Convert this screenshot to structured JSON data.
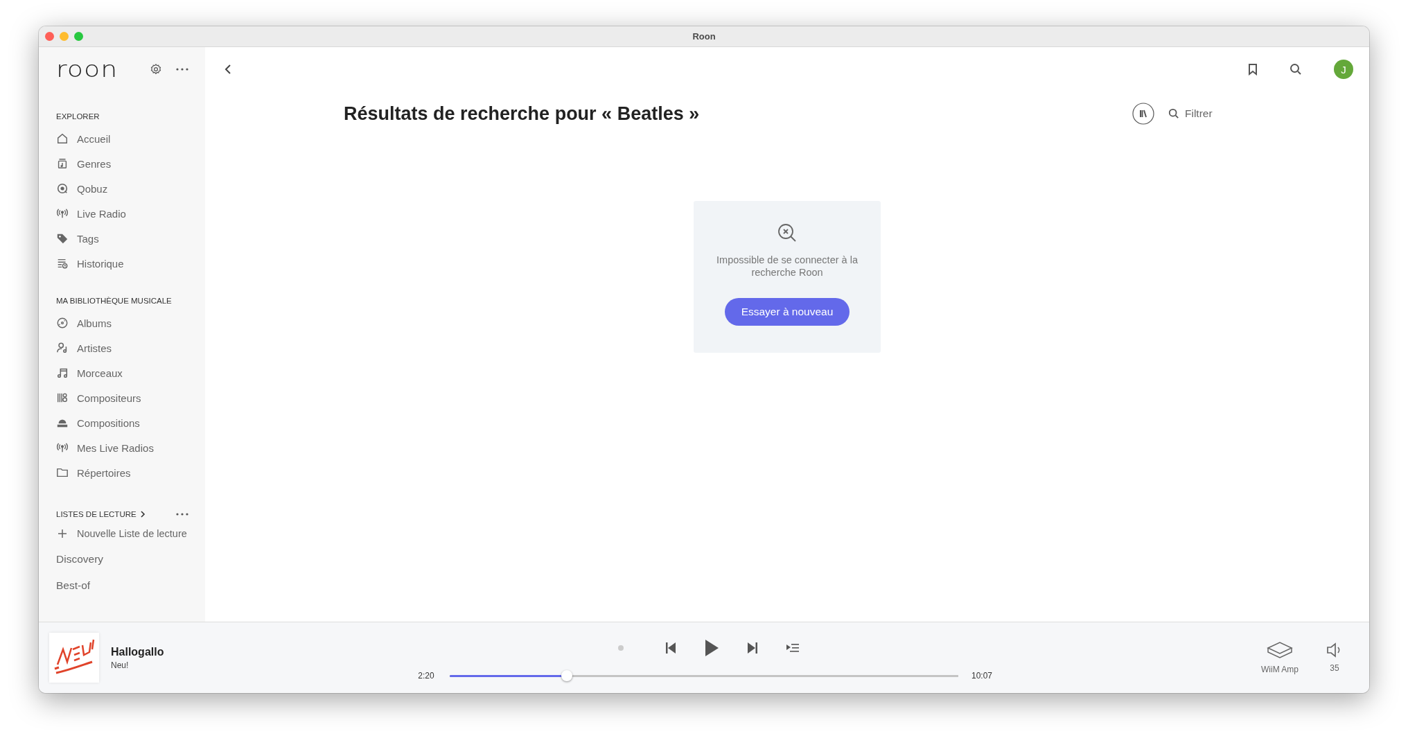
{
  "window": {
    "title": "Roon"
  },
  "sidebar": {
    "logo": "roon",
    "sections": [
      {
        "heading": "EXPLORER",
        "items": [
          {
            "label": "Accueil",
            "kind": "home"
          },
          {
            "label": "Genres",
            "kind": "genres"
          },
          {
            "label": "Qobuz",
            "kind": "qobuz"
          },
          {
            "label": "Live Radio",
            "kind": "radio"
          },
          {
            "label": "Tags",
            "kind": "tag"
          },
          {
            "label": "Historique",
            "kind": "history"
          }
        ]
      },
      {
        "heading": "MA BIBLIOTHÈQUE MUSICALE",
        "items": [
          {
            "label": "Albums",
            "kind": "album"
          },
          {
            "label": "Artistes",
            "kind": "artist"
          },
          {
            "label": "Morceaux",
            "kind": "track"
          },
          {
            "label": "Compositeurs",
            "kind": "composer"
          },
          {
            "label": "Compositions",
            "kind": "composition"
          },
          {
            "label": "Mes Live Radios",
            "kind": "radio"
          },
          {
            "label": "Répertoires",
            "kind": "folder"
          }
        ]
      }
    ],
    "playlists": {
      "heading": "LISTES DE LECTURE",
      "new_item": "Nouvelle Liste de lecture",
      "items": [
        "Discovery",
        "Best-of"
      ]
    }
  },
  "user": {
    "initial": "J"
  },
  "page": {
    "title": "Résultats de recherche pour « Beatles »",
    "filter": {
      "placeholder": "Filtrer"
    }
  },
  "error_card": {
    "message": "Impossible de se connecter à la recherche Roon",
    "button": "Essayer à nouveau"
  },
  "player": {
    "track": "Hallogallo",
    "artist": "Neu!",
    "elapsed": "2:20",
    "duration": "10:07",
    "level": 0.23,
    "zone": "WiiM Amp",
    "volume": "35"
  }
}
